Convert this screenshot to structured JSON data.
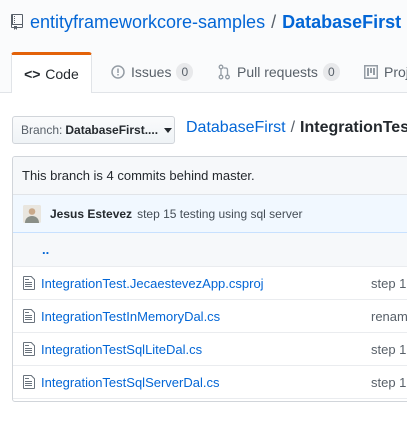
{
  "repo": {
    "owner": "entityframeworkcore-samples",
    "separator": "/",
    "name": "DatabaseFirst",
    "icon": "repo-icon"
  },
  "tabs": [
    {
      "label": "Code",
      "icon": "code-icon",
      "selected": true
    },
    {
      "label": "Issues",
      "icon": "issue-icon",
      "count": "0"
    },
    {
      "label": "Pull requests",
      "icon": "pull-request-icon",
      "count": "0"
    },
    {
      "label": "Proj",
      "icon": "project-icon"
    }
  ],
  "branch": {
    "label": "Branch:",
    "value": "DatabaseFirst....",
    "icon": "caret-down-icon"
  },
  "breadcrumb": {
    "root": "DatabaseFirst",
    "separator": "/",
    "current": "IntegrationTest"
  },
  "branch_info": "This branch is 4 commits behind master.",
  "last_commit": {
    "author": "Jesus Estevez",
    "message": "step 15 testing using sql server"
  },
  "file_list": {
    "up": "..",
    "files": [
      {
        "name": "IntegrationTest.JecaestevezApp.csproj",
        "message": "step 1",
        "icon": "file-icon"
      },
      {
        "name": "IntegrationTestInMemoryDal.cs",
        "message": "renam",
        "icon": "file-icon"
      },
      {
        "name": "IntegrationTestSqlLiteDal.cs",
        "message": "step 1",
        "icon": "file-icon"
      },
      {
        "name": "IntegrationTestSqlServerDal.cs",
        "message": "step 1",
        "icon": "file-icon"
      }
    ]
  },
  "colors": {
    "link": "#0366d6",
    "selected_tab_accent": "#e36209",
    "commit_tease_bg": "#f1f8ff",
    "header_bg": "#fafbfc"
  }
}
